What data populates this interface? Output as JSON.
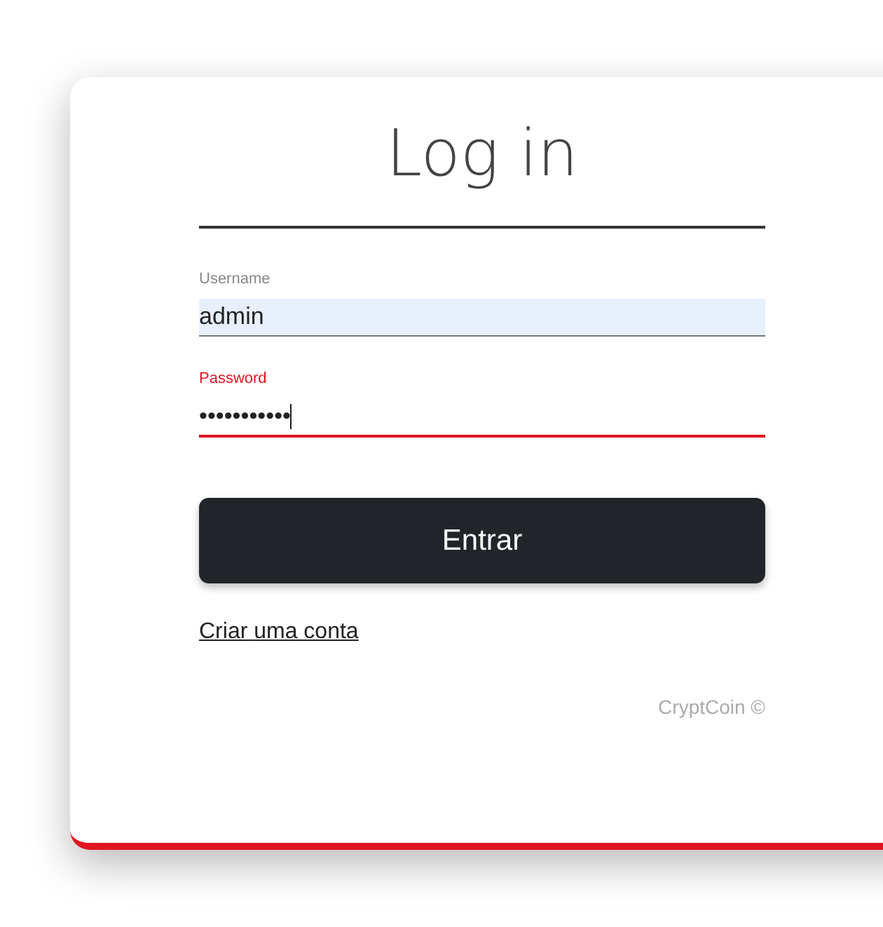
{
  "title": "Log in",
  "fields": [
    {
      "label": "Username",
      "value": "admin",
      "autofilled": true,
      "focused": false
    },
    {
      "label": "Password",
      "value": "•••••••••••",
      "autofilled": false,
      "focused": true
    }
  ],
  "button": "Entrar",
  "link": "Criar uma conta",
  "footer": "CryptCoin ©"
}
